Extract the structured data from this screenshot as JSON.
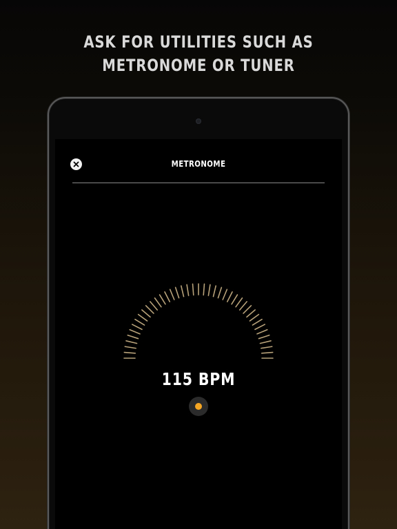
{
  "headline": {
    "line1": "ASK FOR UTILITIES SUCH AS",
    "line2": "METRONOME OR TUNER"
  },
  "screen": {
    "title": "METRONOME",
    "close_icon": "close-icon",
    "bpm_label": "115 BPM",
    "beat_indicator_icon": "dot-icon"
  },
  "colors": {
    "accent": "#f5a623",
    "tick": "#b8a27a",
    "text": "#ffffff",
    "headline_text": "#d9d9d9"
  }
}
